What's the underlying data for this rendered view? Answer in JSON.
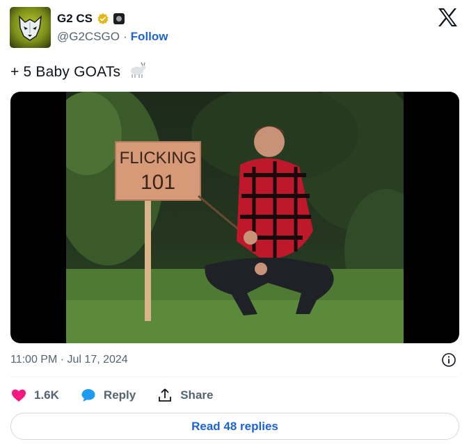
{
  "author": {
    "display_name": "G2 CS",
    "handle": "@G2CSGO",
    "separator": "·",
    "follow_label": "Follow",
    "avatar_icon": "g2-wolf-logo",
    "verified_icon": "gold-verified-badge",
    "affiliate_icon": "affiliate-badge"
  },
  "platform_icon": "x-logo",
  "tweet": {
    "text": "+ 5 Baby GOATs",
    "emoji_icon": "goat-emoji",
    "media": {
      "sign_line1": "FLICKING",
      "sign_line2": "101"
    },
    "timestamp": "11:00 PM · Jul 17, 2024",
    "info_icon": "info-icon"
  },
  "actions": {
    "like_count": "1.6K",
    "reply_label": "Reply",
    "share_label": "Share"
  },
  "read_replies_label": "Read 48 replies",
  "colors": {
    "like": "#f91880",
    "reply": "#1d9bf0",
    "link": "#1d63d8",
    "verified_gold": "#e2b719"
  }
}
